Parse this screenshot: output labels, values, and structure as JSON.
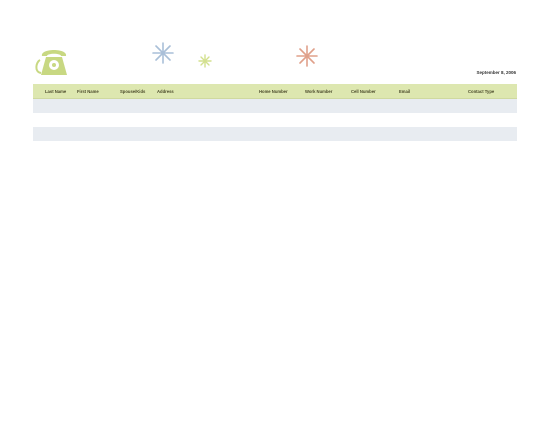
{
  "date": "September 8, 2006",
  "icons": {
    "phone": "telephone-icon",
    "stars": [
      "asterisk-star-blue",
      "asterisk-star-green",
      "asterisk-star-red"
    ]
  },
  "colors": {
    "header_bg": "#dde7b0",
    "row_shade": "#e8ecf1",
    "phone": "#c8d882",
    "star_blue": "#a9bfd8",
    "star_green": "#d3e08e",
    "star_red": "#e0a08a"
  },
  "table": {
    "columns": [
      "Last Name",
      "First Name",
      "Spouse/Kids",
      "Address",
      "Home Number",
      "Work Number",
      "Cell Number",
      "Email",
      "Contact Type"
    ],
    "rows": [
      [
        "",
        "",
        "",
        "",
        "",
        "",
        "",
        "",
        ""
      ],
      [
        "",
        "",
        "",
        "",
        "",
        "",
        "",
        "",
        ""
      ],
      [
        "",
        "",
        "",
        "",
        "",
        "",
        "",
        "",
        ""
      ]
    ]
  }
}
